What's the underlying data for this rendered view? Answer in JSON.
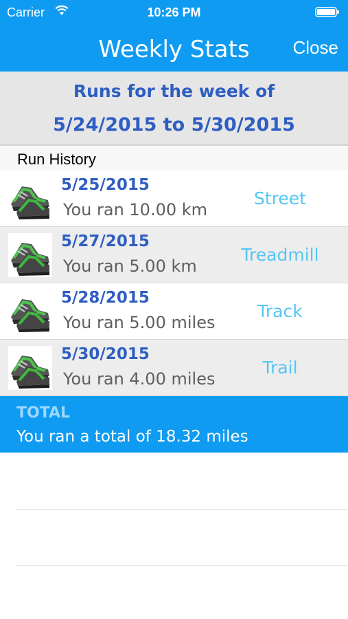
{
  "status_bar": {
    "carrier": "Carrier",
    "time": "10:26 PM"
  },
  "nav": {
    "title": "Weekly Stats",
    "close_label": "Close"
  },
  "week": {
    "line1": "Runs for the week of",
    "line2": "5/24/2015 to 5/30/2015"
  },
  "section_label": "Run History",
  "runs": [
    {
      "date": "5/25/2015",
      "distance": "You ran 10.00 km",
      "type": "Street"
    },
    {
      "date": "5/27/2015",
      "distance": "You ran 5.00 km",
      "type": "Treadmill"
    },
    {
      "date": "5/28/2015",
      "distance": "You ran 5.00 miles",
      "type": "Track"
    },
    {
      "date": "5/30/2015",
      "distance": "You ran 4.00 miles",
      "type": "Trail"
    }
  ],
  "total": {
    "label": "TOTAL",
    "text": "You ran a total of 18.32 miles"
  },
  "colors": {
    "accent": "#0f9bf1",
    "date_text": "#2f5ec2",
    "type_text": "#55c6f3"
  },
  "icons": {
    "run_thumbnail": "running-shoes-icon",
    "wifi": "wifi-icon",
    "battery": "battery-icon"
  }
}
